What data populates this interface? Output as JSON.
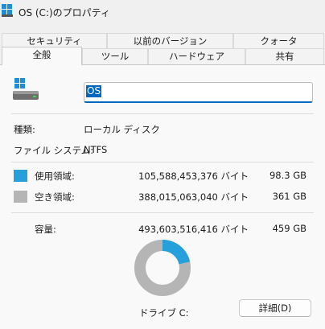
{
  "window": {
    "title": "OS (C:)のプロパティ"
  },
  "tabs_back": [
    {
      "label": "セキュリティ"
    },
    {
      "label": "以前のバージョン"
    },
    {
      "label": "クォータ"
    }
  ],
  "tabs_front": [
    {
      "label": "全般",
      "active": true
    },
    {
      "label": "ツール",
      "active": false
    },
    {
      "label": "ハードウェア",
      "active": false
    },
    {
      "label": "共有",
      "active": false
    }
  ],
  "general": {
    "volume_name": "OS",
    "type_label": "種類:",
    "type_value": "ローカル ディスク",
    "fs_label": "ファイル システム:",
    "fs_value": "NTFS",
    "used": {
      "label": "使用領域:",
      "bytes": "105,588,453,376 バイト",
      "size": "98.3 GB",
      "color": "#26a0da"
    },
    "free": {
      "label": "空き領域:",
      "bytes": "388,015,063,040 バイト",
      "size": "361 GB",
      "color": "#b5b5b5"
    },
    "capacity": {
      "label": "容量:",
      "bytes": "493,603,516,416 バイト",
      "size": "459 GB"
    },
    "used_fraction": 0.2139,
    "drive_label": "ドライブ C:",
    "details_button": "詳細(D)"
  },
  "icons": {
    "title": "windows-drive-icon",
    "drive": "windows-drive-icon"
  }
}
